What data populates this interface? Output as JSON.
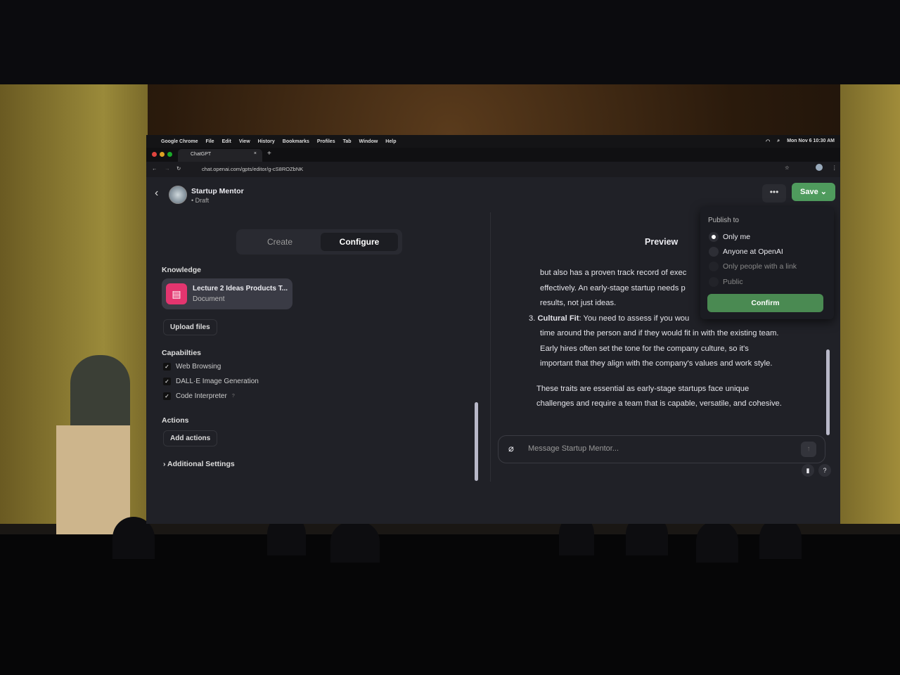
{
  "os_menu": {
    "app": "Google Chrome",
    "items": [
      "File",
      "Edit",
      "View",
      "History",
      "Bookmarks",
      "Profiles",
      "Tab",
      "Window",
      "Help"
    ],
    "clock": "Mon Nov 6  10:30 AM"
  },
  "browser": {
    "tab_title": "ChatGPT",
    "url": "chat.openai.com/gpts/editor/g-cS8ROZbNK"
  },
  "header": {
    "title": "Startup Mentor",
    "status": "Draft",
    "more_label": "•••",
    "save_label": "Save"
  },
  "editor": {
    "tabs": [
      {
        "label": "Create"
      },
      {
        "label": "Configure",
        "active": true
      }
    ],
    "knowledge": {
      "label": "Knowledge",
      "file_name": "Lecture 2 Ideas Products T...",
      "file_type": "Document",
      "upload_label": "Upload files"
    },
    "capabilities": {
      "label": "Capabilties",
      "items": [
        {
          "label": "Web Browsing",
          "checked": true
        },
        {
          "label": "DALL·E Image Generation",
          "checked": true
        },
        {
          "label": "Code Interpreter",
          "checked": true,
          "help": "?"
        }
      ]
    },
    "actions": {
      "label": "Actions",
      "add_label": "Add actions"
    },
    "additional": "Additional Settings"
  },
  "preview": {
    "title": "Preview",
    "lines": [
      "but also has a proven track record of exec",
      "effectively. An early-stage startup needs p",
      "results, not just ideas."
    ],
    "item3_num": "3.",
    "item3_bold": "Cultural Fit",
    "item3_text": ": You need to assess if you wou",
    "item3_lines": [
      "time around the person and if they would fit in with the existing team.",
      "Early hires often set the tone for the company culture, so it's",
      "important that they align with the company's values and work style."
    ],
    "para": [
      "These traits are essential as early-stage startups face unique",
      "challenges and require a team that is capable, versatile, and cohesive."
    ],
    "placeholder": "Message Startup Mentor...",
    "help": "?"
  },
  "publish": {
    "label": "Publish to",
    "options": [
      {
        "label": "Only me",
        "selected": true
      },
      {
        "label": "Anyone at OpenAI"
      },
      {
        "label": "Only people with a link",
        "disabled": true
      },
      {
        "label": "Public",
        "disabled": true
      }
    ],
    "confirm_label": "Confirm"
  },
  "colors": {
    "save": "#4f9b5d",
    "file_icon": "#e3356f",
    "background": "#202127"
  }
}
